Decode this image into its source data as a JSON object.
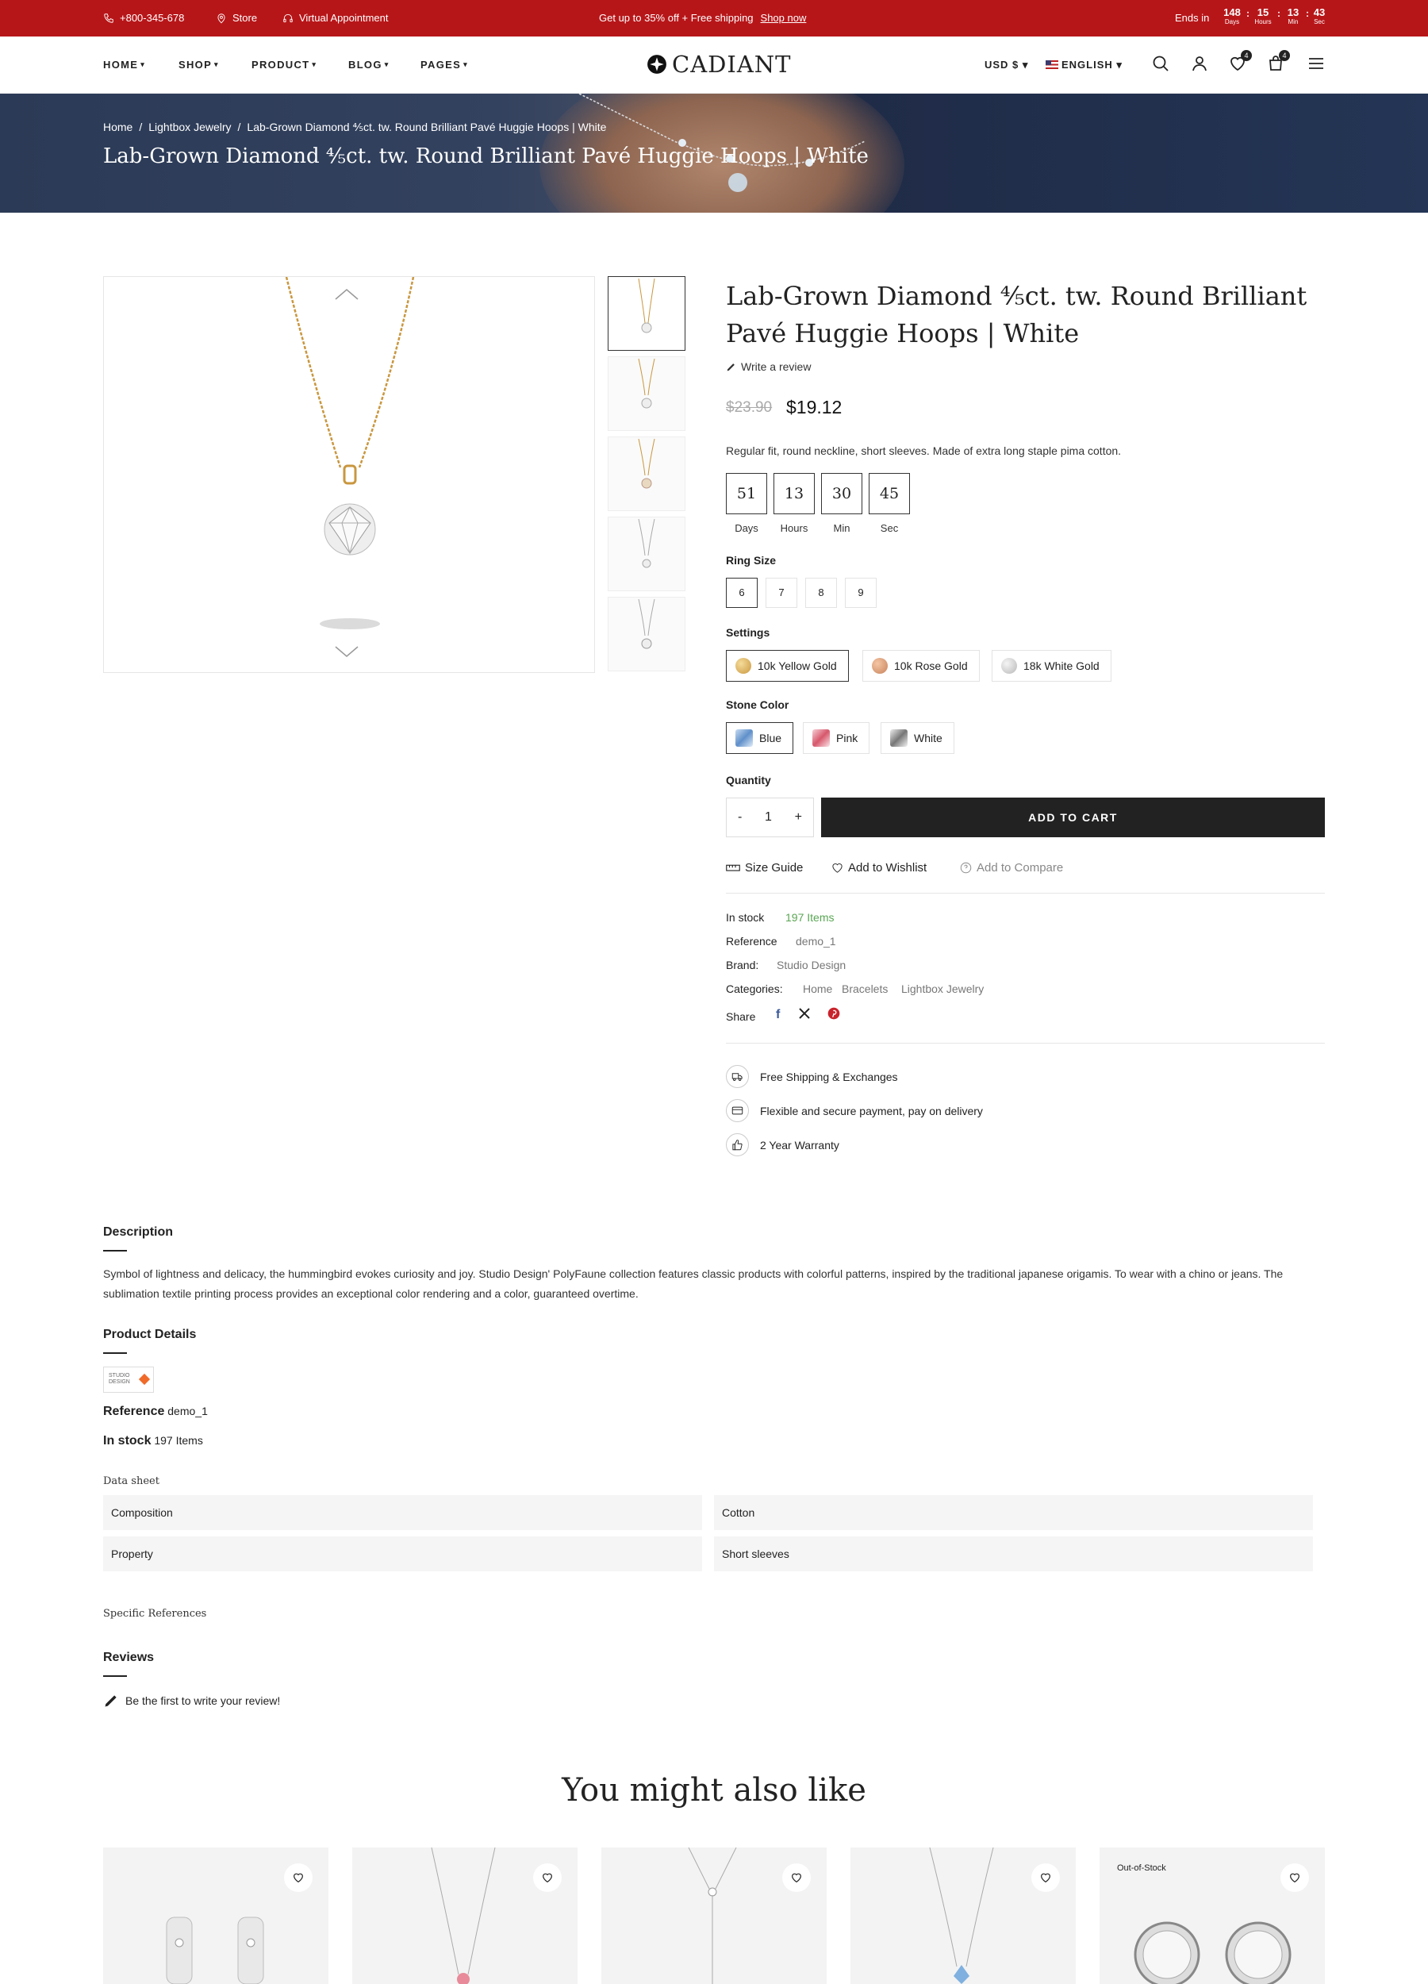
{
  "topbar": {
    "phone": "+800-345-678",
    "store": "Store",
    "appointment": "Virtual Appointment",
    "promo": "Get up to 35% off + Free shipping",
    "promo_link": "Shop now",
    "ends_in": "Ends in",
    "countdown": [
      {
        "value": "148",
        "unit": "Days"
      },
      {
        "value": "15",
        "unit": "Hours"
      },
      {
        "value": "13",
        "unit": "Min"
      },
      {
        "value": "43",
        "unit": "Sec"
      }
    ]
  },
  "nav": [
    "HOME",
    "SHOP",
    "PRODUCT",
    "BLOG",
    "PAGES"
  ],
  "logo": "CADIANT",
  "currency": "USD $",
  "language": "ENGLISH",
  "wishlist_count": "4",
  "cart_count": "4",
  "breadcrumb": [
    "Home",
    "Lightbox Jewelry",
    "Lab-Grown Diamond ⅘ct. tw. Round Brilliant Pavé Huggie Hoops | White"
  ],
  "hero_title": "Lab-Grown Diamond ⅘ct. tw. Round Brilliant Pavé Huggie Hoops | White",
  "product": {
    "title": "Lab-Grown Diamond ⅘ct. tw. Round Brilliant Pavé Huggie Hoops | White",
    "write_review": "Write a review",
    "price_old": "$23.90",
    "price": "$19.12",
    "short_desc": "Regular fit, round neckline, short sleeves. Made of extra long staple pima cotton.",
    "countdown": [
      {
        "value": "51",
        "unit": "Days"
      },
      {
        "value": "13",
        "unit": "Hours"
      },
      {
        "value": "30",
        "unit": "Min"
      },
      {
        "value": "45",
        "unit": "Sec"
      }
    ],
    "ring_size_label": "Ring Size",
    "ring_sizes": [
      "6",
      "7",
      "8",
      "9"
    ],
    "settings_label": "Settings",
    "settings": [
      "10k Yellow Gold",
      "10k Rose Gold",
      "18k White Gold"
    ],
    "stone_label": "Stone Color",
    "stones": [
      "Blue",
      "Pink",
      "White"
    ],
    "quantity_label": "Quantity",
    "quantity": "1",
    "minus": "-",
    "plus": "+",
    "add_to_cart": "ADD TO CART",
    "size_guide": "Size Guide",
    "add_wishlist": "Add to Wishlist",
    "add_compare": "Add to Compare",
    "in_stock_label": "In stock",
    "in_stock_value": "197 Items",
    "reference_label": "Reference",
    "reference_value": "demo_1",
    "brand_label": "Brand:",
    "brand_value": "Studio Design",
    "categories_label": "Categories:",
    "categories": [
      "Home",
      "Bracelets",
      "Lightbox Jewelry"
    ],
    "share_label": "Share",
    "perks": [
      "Free Shipping & Exchanges",
      "Flexible and secure payment, pay on delivery",
      "2 Year Warranty"
    ]
  },
  "details": {
    "description_title": "Description",
    "description": "Symbol of lightness and delicacy, the hummingbird evokes curiosity and joy. Studio Design' PolyFaune collection features classic products with colorful patterns, inspired by the traditional japanese origamis. To wear with a chino or jeans. The sublimation textile printing process provides an exceptional color rendering and a color, guaranteed overtime.",
    "product_details_title": "Product Details",
    "brand_logo_text": "STUDIO DESIGN",
    "reference_label": "Reference",
    "reference_value": "demo_1",
    "stock_label": "In stock",
    "stock_value": "197 Items",
    "data_sheet_title": "Data sheet",
    "data_sheet": [
      [
        "Composition",
        "Cotton"
      ],
      [
        "Property",
        "Short sleeves"
      ]
    ],
    "specific_refs": "Specific References",
    "reviews_title": "Reviews",
    "reviews_empty": "Be the first to write your review!"
  },
  "related": {
    "title": "You might also like",
    "out_of_stock": "Out-of-Stock"
  }
}
